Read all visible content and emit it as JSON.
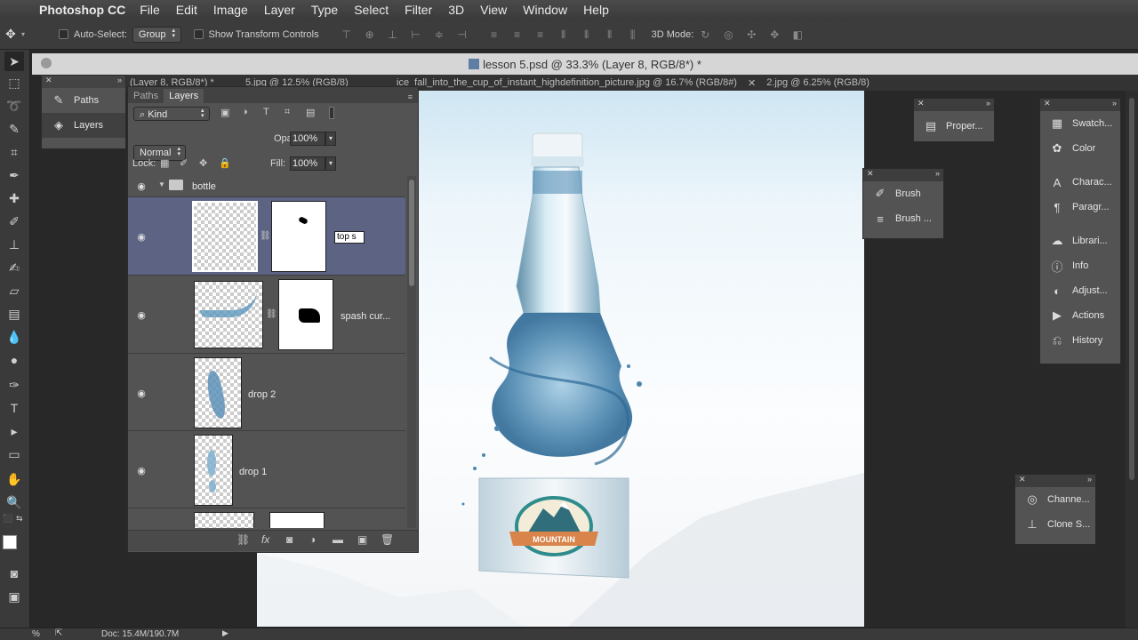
{
  "menubar": {
    "app_name": "Photoshop CC",
    "items": [
      "File",
      "Edit",
      "Image",
      "Layer",
      "Type",
      "Select",
      "Filter",
      "3D",
      "View",
      "Window",
      "Help"
    ]
  },
  "options_bar": {
    "auto_select_label": "Auto-Select:",
    "auto_select_value": "Group",
    "show_transform_label": "Show Transform Controls",
    "mode_3d_label": "3D Mode:"
  },
  "document": {
    "title": "lesson 5.psd @ 33.3% (Layer 8, RGB/8*) *",
    "tabs": [
      "(Layer 8, RGB/8*) *",
      "5.jpg @ 12.5% (RGB/8)",
      "ice_fall_into_the_cup_of_instant_highdefinition_picture.jpg @ 16.7% (RGB/8#)",
      "2.jpg @ 6.25% (RGB/8)"
    ]
  },
  "left_panel": {
    "items": [
      {
        "label": "Paths",
        "icon": "paths-icon"
      },
      {
        "label": "Layers",
        "icon": "layers-icon"
      }
    ]
  },
  "layers_panel": {
    "tabs": [
      "Paths",
      "Layers"
    ],
    "filter_label": "Kind",
    "blend_mode": "Normal",
    "opacity_label": "Opacity:",
    "opacity_value": "100%",
    "lock_label": "Lock:",
    "fill_label": "Fill:",
    "fill_value": "100%",
    "group_name": "bottle",
    "layers": [
      {
        "name": "top s",
        "editing": true
      },
      {
        "name": "spash cur..."
      },
      {
        "name": "drop 2"
      },
      {
        "name": "drop 1"
      }
    ]
  },
  "properties_panel": {
    "label": "Proper..."
  },
  "brush_panel": {
    "items": [
      "Brush",
      "Brush ..."
    ]
  },
  "right_panel": {
    "items": [
      "Swatch...",
      "Color",
      "Charac...",
      "Paragr...",
      "Librari...",
      "Info",
      "Adjust...",
      "Actions",
      "History"
    ]
  },
  "channels_panel": {
    "items": [
      "Channe...",
      "Clone S..."
    ]
  },
  "status_bar": {
    "zoom": "%",
    "doc_info": "Doc: 15.4M/190.7M"
  },
  "logo_text": "MOUNTAIN"
}
